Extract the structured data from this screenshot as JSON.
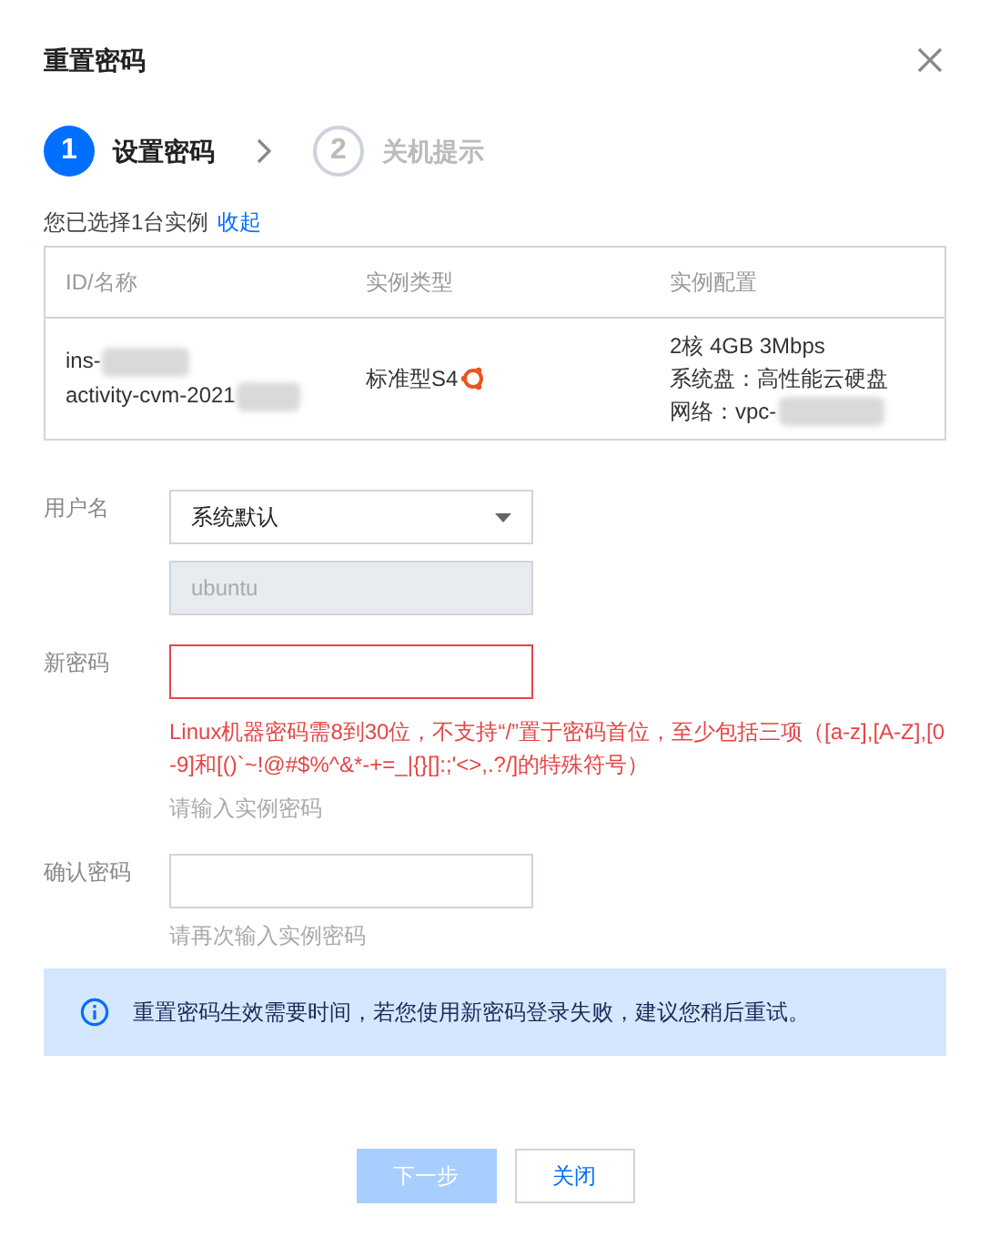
{
  "dialog": {
    "title": "重置密码"
  },
  "steps": [
    {
      "number": "1",
      "label": "设置密码",
      "selected": true
    },
    {
      "number": "2",
      "label": "关机提示",
      "selected": false
    }
  ],
  "selection": {
    "text": "您已选择1台实例",
    "link": "收起"
  },
  "table": {
    "columns": [
      "ID/名称",
      "实例类型",
      "实例配置"
    ],
    "rows": [
      {
        "id_lines": [
          "ins-",
          "activity-cvm-2021"
        ],
        "type": "标准型S4",
        "config_lines": [
          "2核 4GB 3Mbps",
          "系统盘：高性能云硬盘",
          "网络：vpc-"
        ]
      }
    ]
  },
  "form": [
    {
      "kind": "select",
      "label": "用户名",
      "value": "系统默认"
    },
    {
      "kind": "readonly",
      "value": "ubuntu"
    },
    {
      "kind": "input",
      "label": "新密码",
      "error": true,
      "error_text": "Linux机器密码需8到30位，不支持“/”置于密码首位，至少包括三项（[a-z],[A-Z],[0-9]和[()`~!@#$%^&*-+=_|{}[]:;'<>,.?/]的特殊符号）",
      "hint": "请输入实例密码"
    },
    {
      "kind": "input",
      "label": "确认密码",
      "error": false,
      "hint": "请再次输入实例密码"
    }
  ],
  "notice": "重置密码生效需要时间，若您使用新密码登录失败，建议您稍后重试。",
  "buttons": [
    {
      "label": "下一步",
      "kind": "primary",
      "disabled": true
    },
    {
      "label": "关闭",
      "kind": "default",
      "disabled": false
    }
  ]
}
